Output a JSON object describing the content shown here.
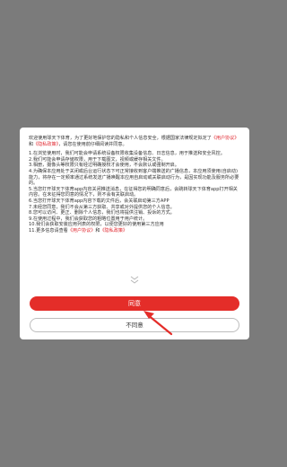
{
  "dialog": {
    "intro_pre": "欢迎使用球天下体育，为了更好地保护您的隐私和个人信息安全，根据国家法律规定拟定了",
    "link_user_agreement": "《用户协议》",
    "intro_and": "和",
    "link_privacy_policy": "《隐私政策》",
    "intro_post": "，请您在使用前仔细阅读并同意。",
    "items": [
      "1.在浏览使用时，我们可能会申请系统设备权限收集设备信息、日志信息，用于推送和安全风控。",
      "2.我们可能会申请存储权限，用于下载图文，视频或缓存相关文件。",
      "3.相册，摄像头等权限只有经过明确授权才会使用，不会默认或强制开启。",
      "4.为确保本应用处于关闭或后台运行状态下可正常接收到客户端推送的广播信息，本应用须使用(自启动)能力，将存在一定频率通过系统发送广播唤醒本应用自启动或关联启动行为，是因实现功能及服务所必要的。",
      "5.当您打开球天下体育app内容关闭推送消息，在征得您的明确同意后，会跳转球天下体育app打开相关内容。在未征得您同意的情况下，则不会有关联启动。",
      "6.当您打开球天下体育app内容下载的文件后，会关联启动第三方APP",
      "7.未经您同意，我们不会从第三方获取、共享或对外提供您的个人信息。",
      "8.您可以访问、更正、删除个人信息，我们也将提供注销、投诉的方式。",
      "9.在使用过程中，我们会获取您的粗略位置用于用户统计。",
      "10.我们会获取安装应用列表的权限，以便您更好的使用第三方应用"
    ],
    "last_item_pre": "11.更多信息请查看",
    "last_item_mid": "和",
    "agree_label": "同意",
    "disagree_label": "不同意"
  },
  "colors": {
    "overlay": "#7b7b7b",
    "accent": "#e42d29",
    "link": "#e0262e"
  },
  "icons": {
    "more": "double-chevron-down-icon",
    "arrow": "pointer-arrow-icon"
  }
}
